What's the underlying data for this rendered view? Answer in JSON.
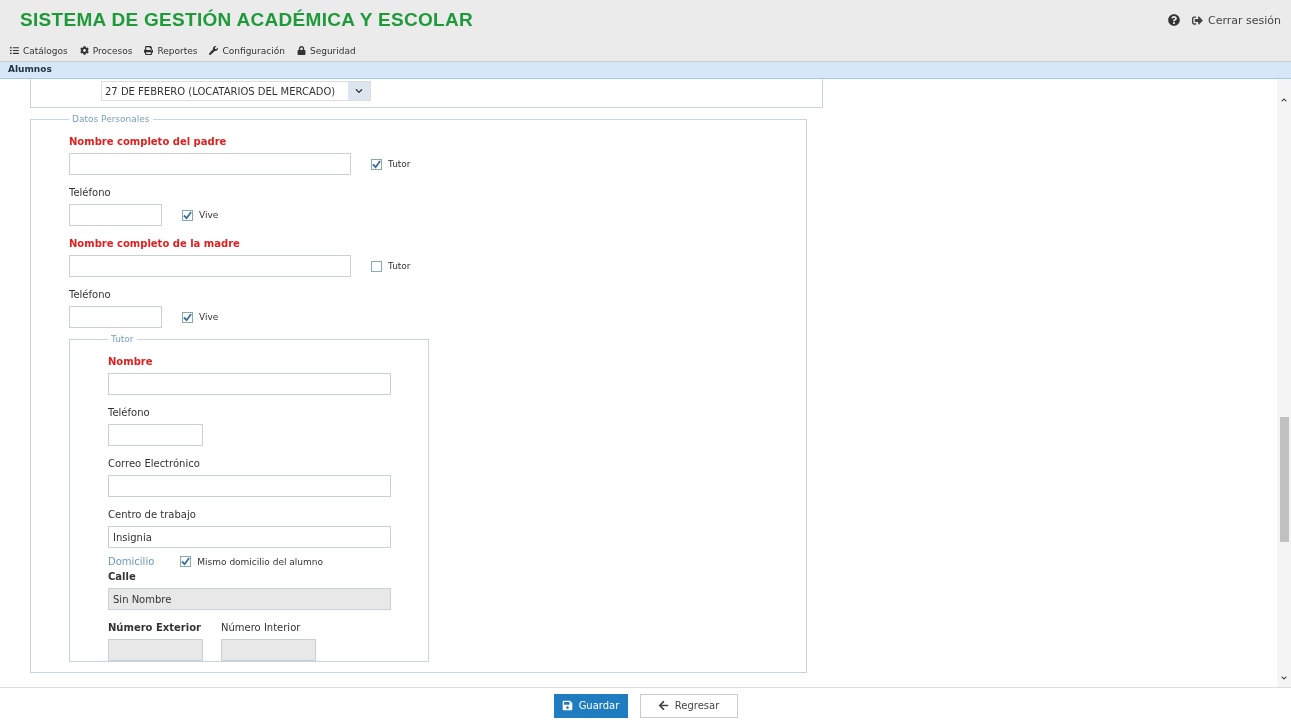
{
  "header": {
    "title": "SISTEMA DE GESTIÓN ACADÉMICA Y ESCOLAR",
    "logout": "Cerrar sesión"
  },
  "menu": [
    "Catálogos",
    "Procesos",
    "Reportes",
    "Configuración",
    "Seguridad"
  ],
  "breadcrumb": "Alumnos",
  "school_select": {
    "value": "27 DE FEBRERO (LOCATARIOS DEL MERCADO)"
  },
  "personal": {
    "legend": "Datos Personales",
    "parents": [
      {
        "label": "Nombre completo del padre",
        "tutor_label": "Tutor",
        "tutor": true,
        "phone_label": "Teléfono",
        "alive_label": "Vive",
        "alive": true
      },
      {
        "label": "Nombre completo de la madre",
        "tutor_label": "Tutor",
        "tutor": false,
        "phone_label": "Teléfono",
        "alive_label": "Vive",
        "alive": true
      }
    ],
    "tutor": {
      "legend": "Tutor",
      "name_label": "Nombre",
      "phone_label": "Teléfono",
      "email_label": "Correo Electrónico",
      "work_label": "Centro de trabajo",
      "work_value": "Insignia",
      "address_label": "Domicilio",
      "same_address_label": "Mismo domicilio del alumno",
      "same_address": true,
      "street_label": "Calle",
      "street_value": "Sin Nombre",
      "ext_label": "Número Exterior",
      "int_label": "Número Interior"
    }
  },
  "buttons": {
    "save": "Guardar",
    "back": "Regresar"
  }
}
